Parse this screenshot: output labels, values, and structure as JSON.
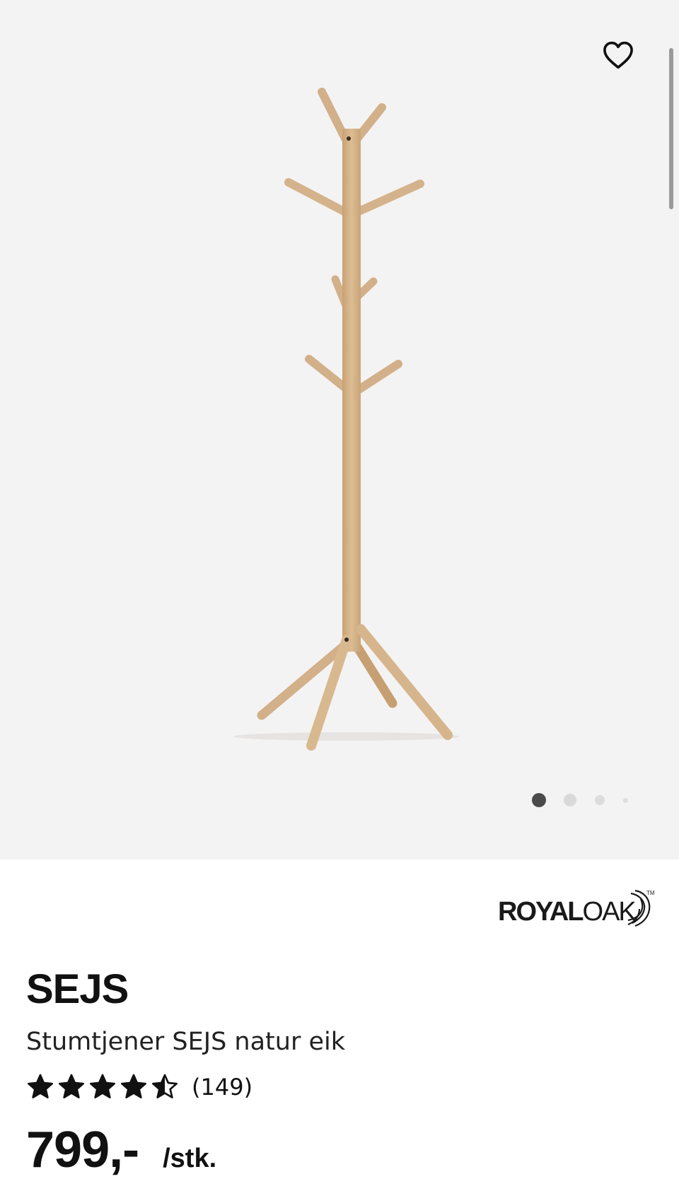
{
  "gallery": {
    "image": "coat-stand-product-photo",
    "dots_total": 4,
    "active_dot": 1
  },
  "favorite": {
    "icon": "heart-outline-icon"
  },
  "brand": {
    "logo_bold": "ROYAL",
    "logo_light": "OAK",
    "trademark": "TM"
  },
  "product": {
    "name": "SEJS",
    "description": "Stumtjener SEJS natur eik",
    "rating": {
      "value": 4.5,
      "max": 5,
      "count_label": "(149)"
    },
    "price": {
      "value": "799,-",
      "unit": "/stk."
    }
  },
  "colors": {
    "oak": "#d6b48a",
    "gallery_bg": "#f4f3f3",
    "text": "#111111"
  }
}
